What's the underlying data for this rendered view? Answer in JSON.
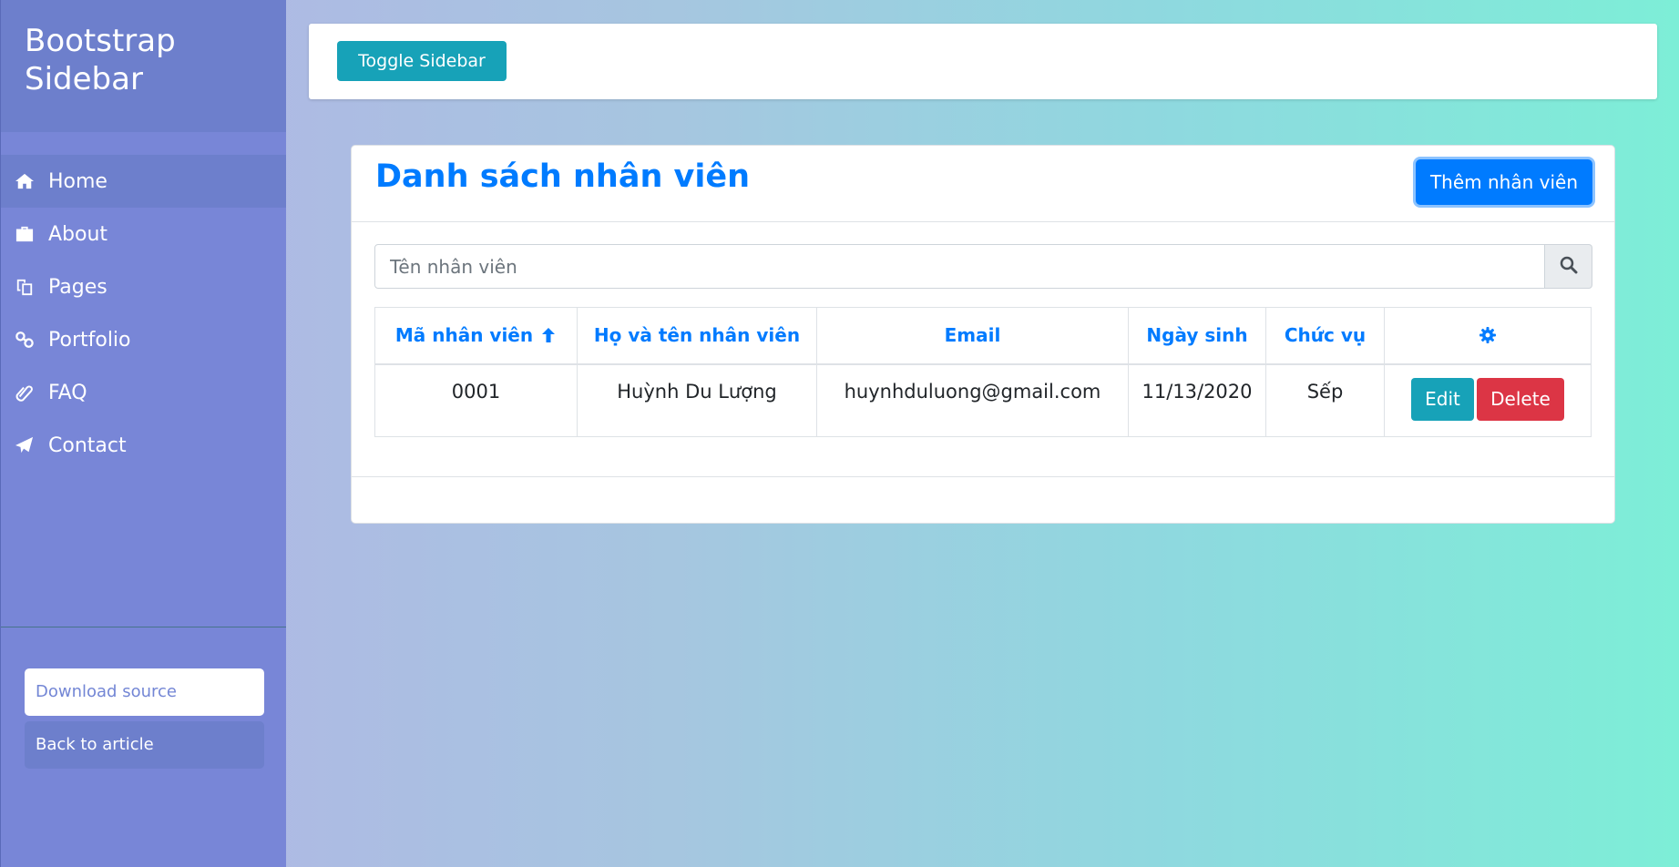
{
  "sidebar": {
    "title_line1": "Bootstrap",
    "title_line2": "Sidebar",
    "items": [
      {
        "label": "Home",
        "icon": "home-icon"
      },
      {
        "label": "About",
        "icon": "briefcase-icon"
      },
      {
        "label": "Pages",
        "icon": "copy-icon"
      },
      {
        "label": "Portfolio",
        "icon": "link-icon"
      },
      {
        "label": "FAQ",
        "icon": "paperclip-icon"
      },
      {
        "label": "Contact",
        "icon": "paper-plane-icon"
      }
    ],
    "download_label": "Download source",
    "back_label": "Back to article"
  },
  "topbar": {
    "toggle_label": "Toggle Sidebar"
  },
  "card": {
    "title": "Danh sách nhân viên",
    "add_label": "Thêm nhân viên",
    "search_placeholder": "Tên nhân viên",
    "columns": [
      "Mã nhân viên",
      "Họ và tên nhân viên",
      "Email",
      "Ngày sinh",
      "Chức vụ"
    ],
    "rows": [
      {
        "id": "0001",
        "name": "Huỳnh Du Lượng",
        "email": "huynhduluong@gmail.com",
        "dob": "11/13/2020",
        "role": "Sếp"
      }
    ],
    "edit_label": "Edit",
    "delete_label": "Delete"
  },
  "colors": {
    "primary": "#007bff",
    "info": "#17a2b8",
    "danger": "#dc3545",
    "sidebar": "#7886d7"
  }
}
